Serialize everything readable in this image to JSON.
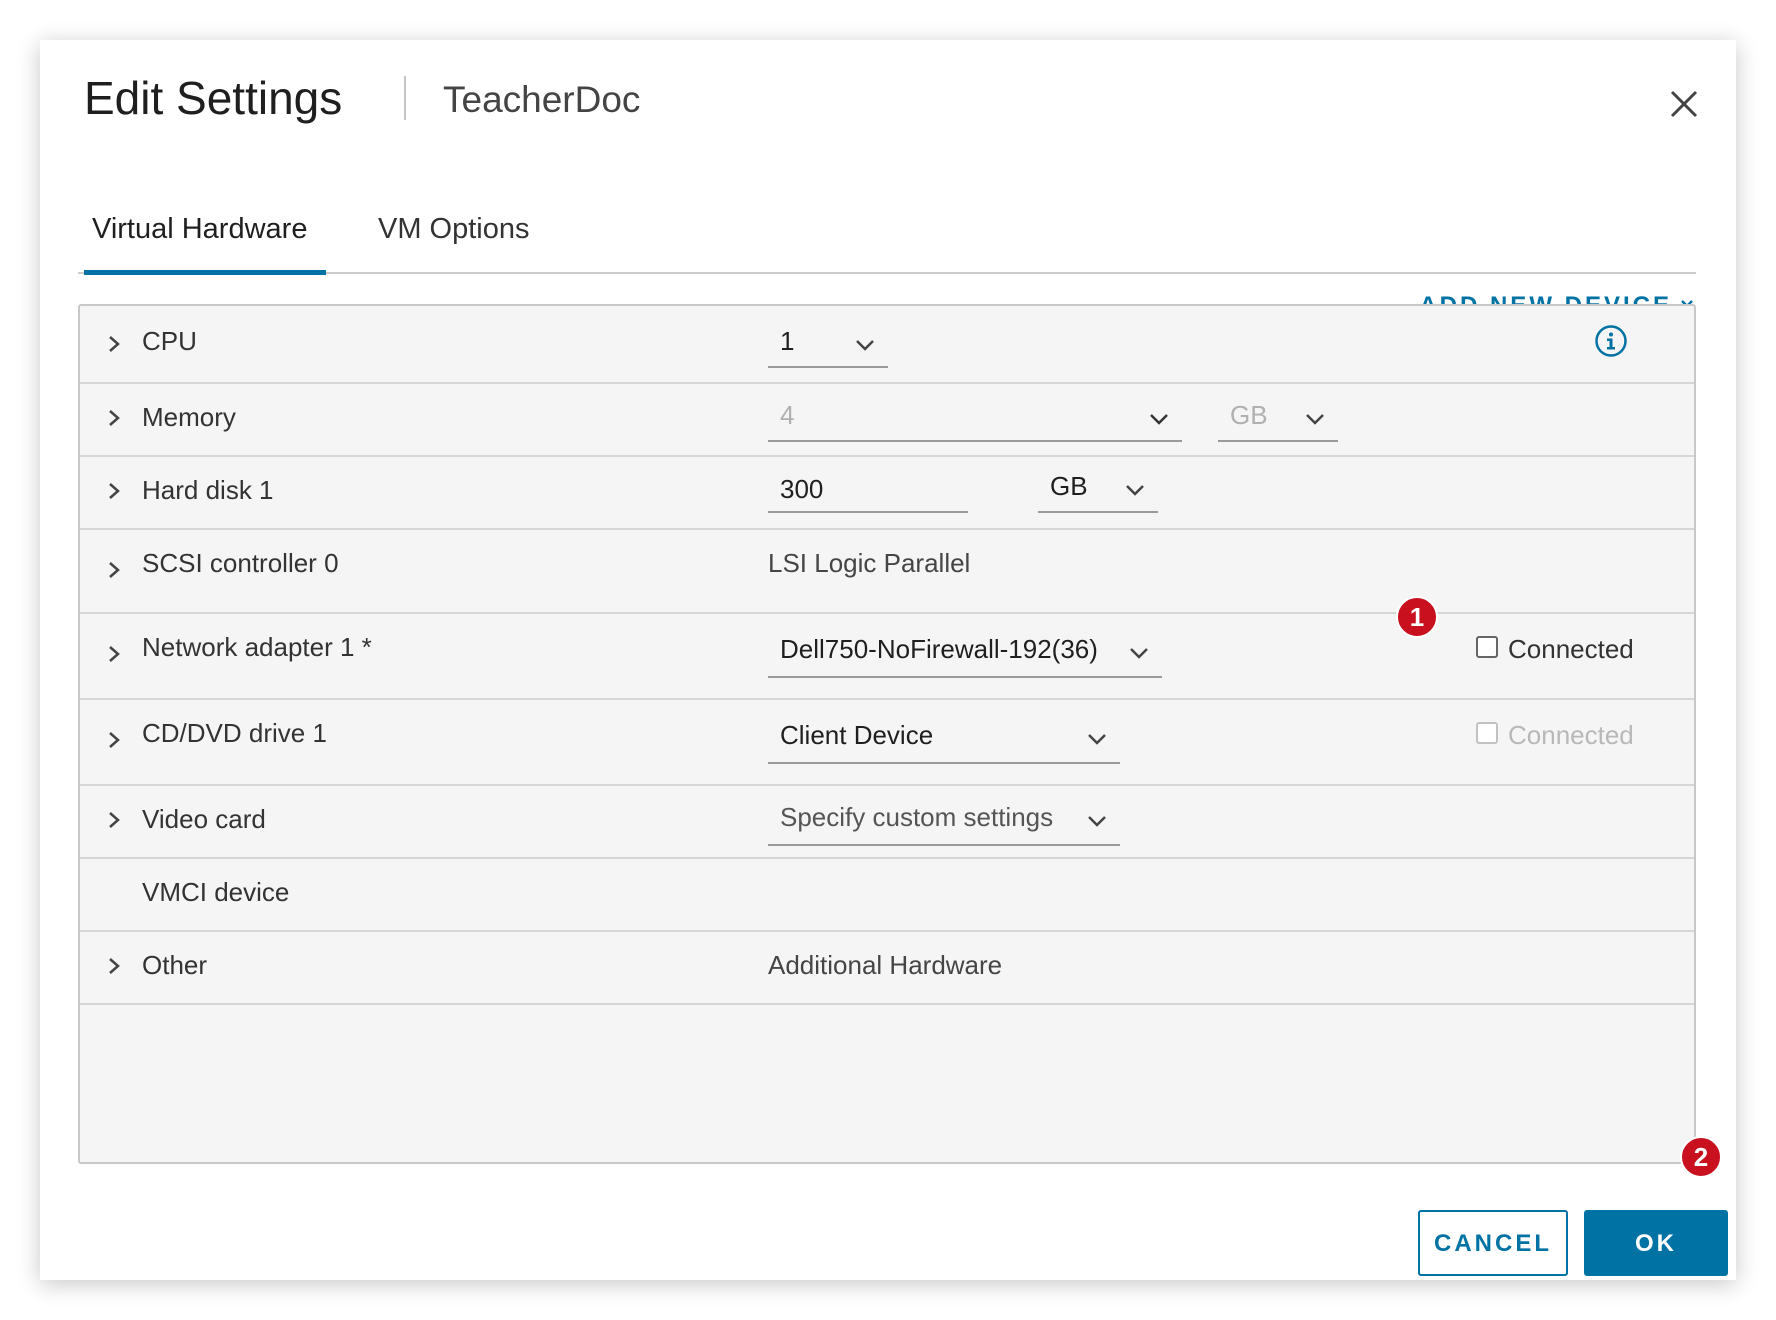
{
  "dialog": {
    "title": "Edit Settings",
    "subtitle": "TeacherDoc",
    "close_icon": "close-icon"
  },
  "tabs": [
    {
      "label": "Virtual Hardware",
      "active": true
    },
    {
      "label": "VM Options",
      "active": false
    }
  ],
  "add_device": {
    "label": "ADD NEW DEVICE",
    "icon": "chevron-down-icon"
  },
  "rows": {
    "cpu": {
      "label": "CPU",
      "value": "1"
    },
    "memory": {
      "label": "Memory",
      "value": "4",
      "unit": "GB"
    },
    "hard_disk": {
      "label": "Hard disk 1",
      "value": "300",
      "unit": "GB"
    },
    "scsi": {
      "label": "SCSI controller 0",
      "value": "LSI Logic Parallel"
    },
    "network": {
      "label": "Network adapter 1 *",
      "value": "Dell750-NoFirewall-192(36)",
      "connected_label": "Connected",
      "connected": false
    },
    "cdrom": {
      "label": "CD/DVD drive 1",
      "value": "Client Device",
      "connected_label": "Connected",
      "connected": false
    },
    "video": {
      "label": "Video card",
      "value": "Specify custom settings"
    },
    "vmci": {
      "label": "VMCI device"
    },
    "other": {
      "label": "Other",
      "value": "Additional Hardware"
    }
  },
  "badges": {
    "one": "1",
    "two": "2"
  },
  "footer": {
    "cancel_label": "CANCEL",
    "ok_label": "OK"
  },
  "colors": {
    "accent": "#0072a3",
    "badge": "#c8101f"
  }
}
